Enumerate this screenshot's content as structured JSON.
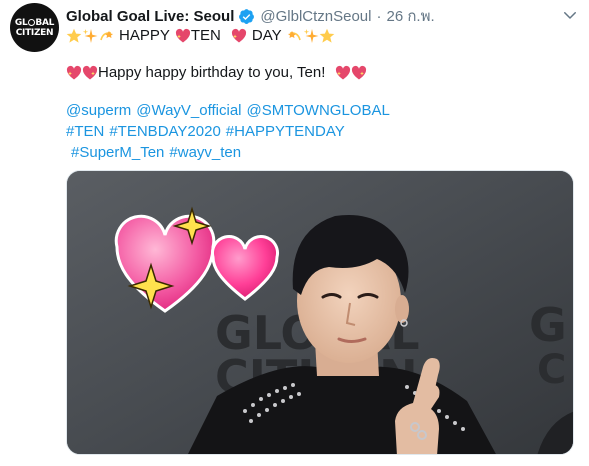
{
  "tweet": {
    "avatar_text_line1": "GL BAL",
    "avatar_text_line2": "CITIZEN",
    "display_name": "Global Goal Live: Seoul",
    "handle": "@GlblCtznSeoul",
    "separator": "·",
    "timestamp": "26 ก.พ.",
    "line1_word1": "HAPPY",
    "line1_word2": "TEN",
    "line1_word3": "DAY",
    "birthday_message": "Happy happy birthday to you, Ten!",
    "mentions": [
      "@superm",
      "@WayV_official",
      "@SMTOWNGLOBAL"
    ],
    "hashtags_line1": [
      "#TEN",
      "#TENBDAY2020",
      "#HAPPYTENDAY"
    ],
    "hashtags_line2": [
      "#SuperM_Ten",
      "#wayv_ten"
    ],
    "photo_backdrop_text_1": "GLOBAL",
    "photo_backdrop_text_2": "CITIZEN."
  },
  "colors": {
    "link": "#1b95e0",
    "text": "#14171a",
    "secondary": "#657786",
    "verified": "#1da1f2"
  },
  "icons": [
    "verified-badge-icon",
    "chevron-down-icon",
    "star-emoji-icon",
    "sparkles-emoji-icon",
    "dizzy-emoji-icon",
    "sparkling-heart-emoji-icon",
    "two-hearts-emoji-icon",
    "pink-heart-sticker"
  ]
}
